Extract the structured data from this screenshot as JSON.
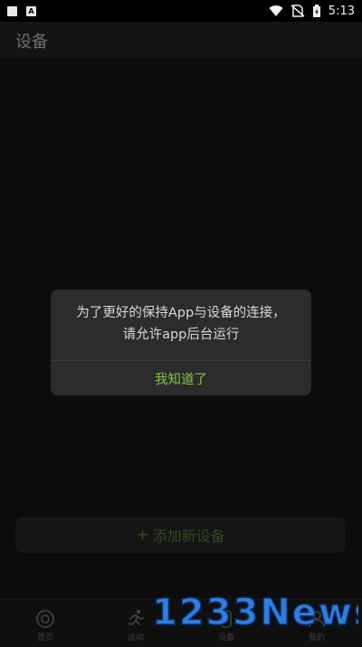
{
  "status_bar": {
    "time": "5:13",
    "left_icons": [
      "notification-square-icon",
      "font-a-icon"
    ],
    "right_icons": [
      "wifi-icon",
      "no-sim-icon",
      "battery-icon"
    ]
  },
  "header": {
    "title": "设备"
  },
  "add_device": {
    "plus": "+",
    "label": "添加新设备"
  },
  "dialog": {
    "message_line1": "为了更好的保持App与设备的连接，",
    "message_line2": "请允许app后台运行",
    "confirm_label": "我知道了"
  },
  "bottom_nav": {
    "items": [
      {
        "label": "首页",
        "icon": "home-target-icon"
      },
      {
        "label": "运动",
        "icon": "running-icon"
      },
      {
        "label": "设备",
        "icon": "device-icon"
      },
      {
        "label": "我的",
        "icon": "profile-icon"
      }
    ]
  },
  "watermark": {
    "text": "1233News"
  },
  "colors": {
    "accent": "#8cc04a",
    "dialog_bg": "#2c2c2c",
    "background": "#0a0a0a"
  }
}
